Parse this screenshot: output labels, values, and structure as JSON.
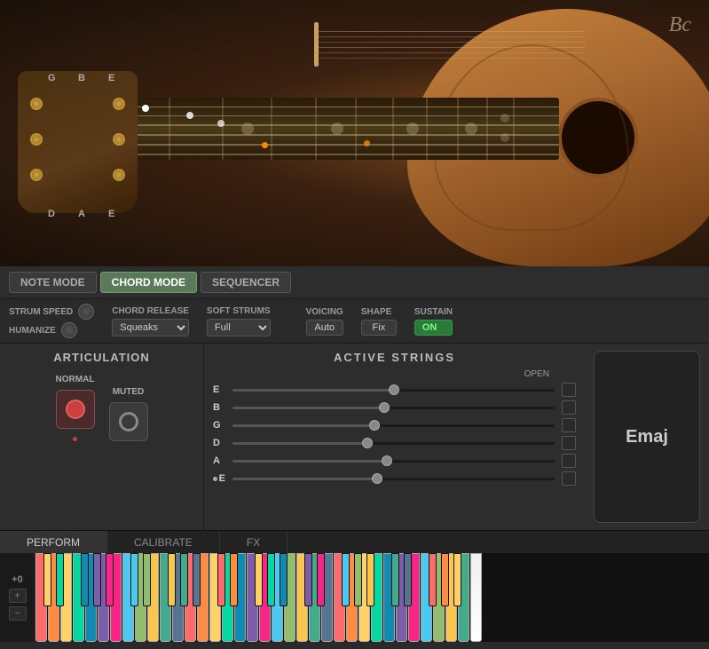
{
  "guitar": {
    "tuning_labels": [
      "G",
      "B",
      "E",
      "D",
      "A",
      "E"
    ],
    "brand_initials": "Bc"
  },
  "mode_bar": {
    "buttons": [
      "NOTE MODE",
      "CHORD MODE",
      "SEQUENCER"
    ],
    "active": "CHORD MODE"
  },
  "controls": {
    "strum_speed_label": "STRUM SPEED",
    "humanize_label": "HUMANIZE",
    "chord_release_label": "CHORD RELEASE",
    "chord_release_value": "Squeaks",
    "soft_strums_label": "SOFT STRUMS",
    "soft_strums_value": "Full",
    "voicing_label": "VOICING",
    "voicing_value": "Auto",
    "shape_label": "SHAPE",
    "shape_value": "Fix",
    "sustain_label": "SUSTAIN",
    "sustain_value": "ON"
  },
  "active_strings": {
    "title": "ACTIVE STRINGS",
    "open_label": "OPEN",
    "strings": [
      {
        "label": "E",
        "position": 50,
        "active": false
      },
      {
        "label": "B",
        "position": 47,
        "active": false
      },
      {
        "label": "G",
        "position": 44,
        "active": false
      },
      {
        "label": "D",
        "position": 42,
        "active": false
      },
      {
        "label": "A",
        "position": 48,
        "active": false
      },
      {
        "label": "E",
        "position": 45,
        "active": false,
        "dot": true
      }
    ]
  },
  "articulation": {
    "title": "ARTICULATION",
    "normal_label": "NORMAL",
    "muted_label": "MUTED"
  },
  "chord_display": {
    "value": "Emaj"
  },
  "tabs": [
    {
      "id": "perform",
      "label": "PERFORM",
      "active": true
    },
    {
      "id": "calibrate",
      "label": "CALIBRATE",
      "active": false
    },
    {
      "id": "fx",
      "label": "FX",
      "active": false
    }
  ],
  "piano": {
    "pitch_label": "+0",
    "plus_label": "+",
    "minus_label": "−",
    "key_colors": [
      "#ff6b6b",
      "#ff8c42",
      "#ffd166",
      "#06d6a0",
      "#118ab2",
      "#7b5ea7",
      "#f72585",
      "#4cc9f0",
      "#90be6d",
      "#f9c74f",
      "#43aa8b",
      "#577590",
      "#ff6b6b",
      "#ff8c42",
      "#ffd166",
      "#06d6a0",
      "#118ab2",
      "#7b5ea7",
      "#f72585",
      "#4cc9f0",
      "#90be6d",
      "#f9c74f",
      "#43aa8b",
      "#577590",
      "#ff6b6b",
      "#ff8c42",
      "#ffd166",
      "#06d6a0",
      "#118ab2",
      "#7b5ea7",
      "#f72585",
      "#4cc9f0",
      "#90be6d",
      "#f9c74f",
      "#43aa8b",
      "#577590"
    ]
  }
}
